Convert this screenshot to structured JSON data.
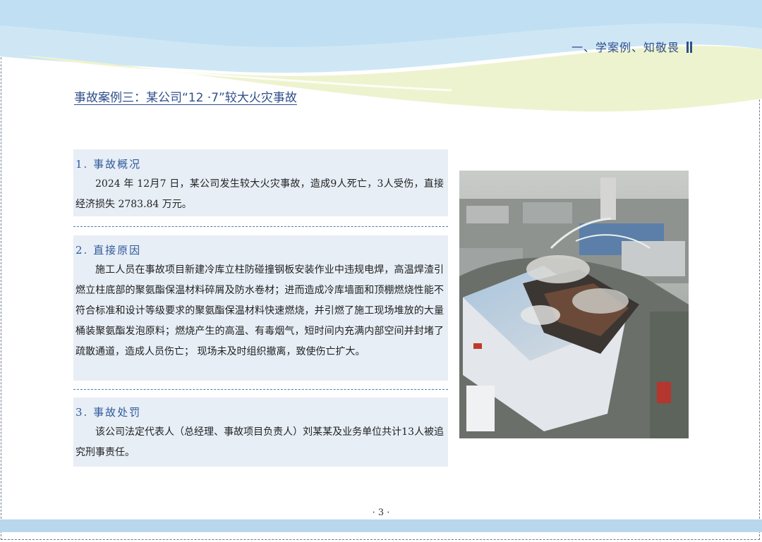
{
  "header": {
    "section": "一、学案例、知敬畏"
  },
  "title": "事故案例三：某公司“12 ·7”较大火灾事故",
  "sections": [
    {
      "heading": "1. 事故概况",
      "body": "2024 年 12月7 日，某公司发生较大火灾事故，造成9人死亡，3人受伤，直接经济损失 2783.84 万元。"
    },
    {
      "heading": "2. 直接原因",
      "body": "施工人员在事故项目新建冷库立柱防碰撞钢板安装作业中违规电焊，高温焊渣引燃立柱底部的聚氨酯保温材料碎屑及防水卷材；进而造成冷库墙面和顶棚燃烧性能不符合标准和设计等级要求的聚氨酯保温材料快速燃烧，并引燃了施工现场堆放的大量桶装聚氨酯发泡原料；燃烧产生的高温、有毒烟气，短时间内充满内部空间并封堵了疏散通道，造成人员伤亡； 现场未及时组织撤离，致使伤亡扩大。"
    },
    {
      "heading": "3. 事故处罚",
      "body": "该公司法定代表人（总经理、事故项目负责人）刘某某及业务单位共计13人被追究刑事责任。"
    }
  ],
  "page_number": "· 3 ·",
  "colors": {
    "accent": "#2f4f8a",
    "panel": "#e7eef6",
    "wave_blue": "#c9e4f4",
    "wave_green": "#eef3cf"
  }
}
